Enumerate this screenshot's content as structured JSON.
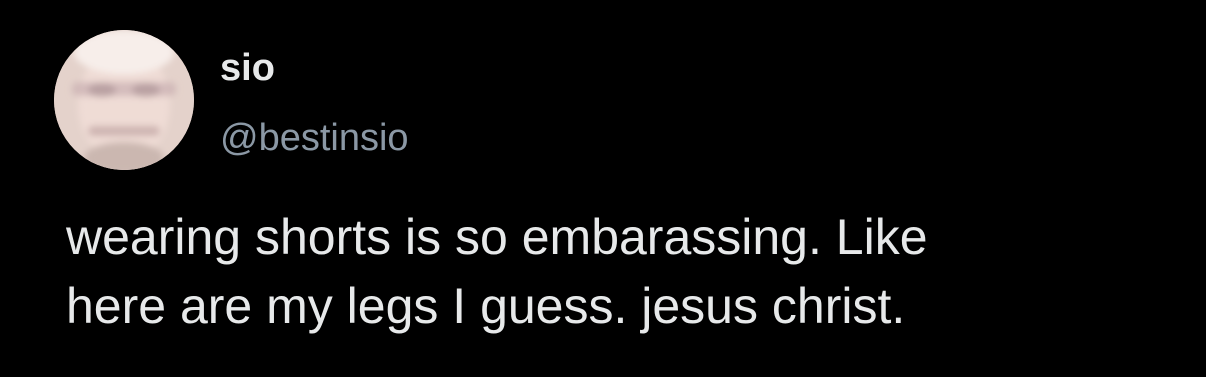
{
  "tweet": {
    "display_name": "sio",
    "handle": "@bestinsio",
    "text": "wearing shorts is so embarassing. Like\nhere are my legs I guess. jesus christ.",
    "avatar": "profile-photo"
  },
  "colors": {
    "background": "#000000",
    "primary_text": "#e7e9ea",
    "secondary_text": "#8b98a5"
  }
}
